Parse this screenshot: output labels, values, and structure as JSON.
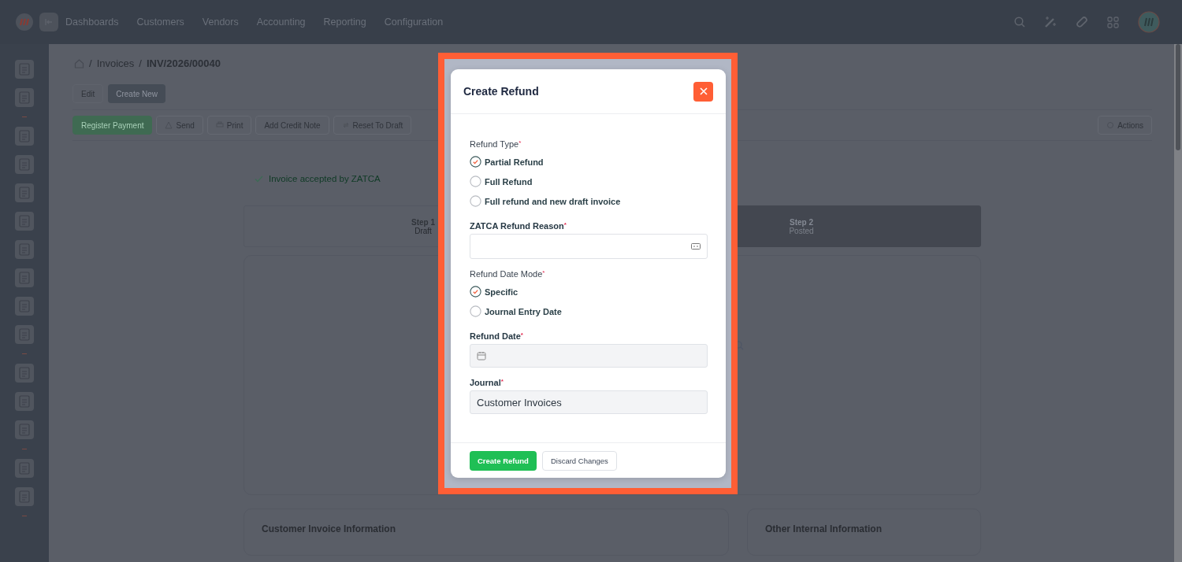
{
  "top_nav": {
    "items": [
      "Dashboards",
      "Customers",
      "Vendors",
      "Accounting",
      "Reporting",
      "Configuration"
    ]
  },
  "breadcrumb": {
    "separator": "/",
    "items": [
      "Invoices",
      "INV/2026/00040"
    ]
  },
  "record_buttons": [
    {
      "label": "Edit",
      "kind": "plain"
    },
    {
      "label": "Create New",
      "kind": "dark"
    }
  ],
  "toolbar": [
    {
      "label": "Register Payment",
      "kind": "primary"
    },
    {
      "label": "Send",
      "kind": "send"
    },
    {
      "label": "Print",
      "kind": "print"
    },
    {
      "label": "Add Credit Note",
      "kind": "plain"
    },
    {
      "label": "Reset To Draft",
      "kind": "reset"
    }
  ],
  "actions_button": "Actions",
  "status_message": "Invoice accepted by ZATCA",
  "steps": [
    {
      "title": "Step 1",
      "subtitle": "Draft",
      "selected": false
    },
    {
      "title": "Step 2",
      "subtitle": "Posted",
      "selected": true
    }
  ],
  "sections": [
    "Customer Invoice Information",
    "Other Internal Information"
  ],
  "dialog": {
    "title": "Create Refund",
    "fields": [
      {
        "kind": "radio",
        "label": "Refund Type",
        "mark": "*",
        "options": [
          {
            "label": "Partial Refund",
            "selected": true
          },
          {
            "label": "Full Refund",
            "selected": false
          },
          {
            "label": "Full refund and new draft invoice",
            "selected": false
          }
        ]
      },
      {
        "kind": "select",
        "label": "ZATCA Refund Reason",
        "mark": "*"
      },
      {
        "kind": "radio",
        "label": "Refund Date Mode",
        "mark": "*",
        "options": [
          {
            "label": "Specific",
            "selected": true
          },
          {
            "label": "Journal Entry Date",
            "selected": false
          }
        ]
      },
      {
        "kind": "date",
        "label": "Refund Date",
        "mark": "*"
      },
      {
        "kind": "text",
        "label": "Journal",
        "mark": "*",
        "value": "Customer Invoices"
      }
    ],
    "buttons": [
      {
        "label": "Create Refund",
        "kind": "primary"
      },
      {
        "label": "Discard Changes",
        "kind": "secondary"
      }
    ]
  }
}
